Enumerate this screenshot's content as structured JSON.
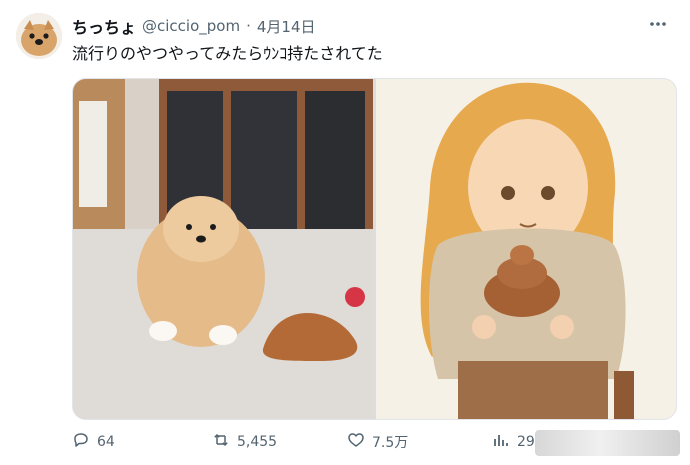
{
  "tweet": {
    "display_name": "ちっちょ",
    "handle": "@ciccio_pom",
    "separator": "·",
    "date": "4月14日",
    "text": "流行りのやつやってみたらｳﾝｺ持たされてた"
  },
  "icons": {
    "more": "more-icon",
    "reply": "reply-icon",
    "retweet": "retweet-icon",
    "like": "heart-icon",
    "views": "views-icon"
  },
  "stats": {
    "replies": "64",
    "retweets": "5,455",
    "likes": "7.5万",
    "views": "29"
  },
  "colors": {
    "text": "#0f1419",
    "secondary": "#536471",
    "border": "#e1e4e8"
  }
}
